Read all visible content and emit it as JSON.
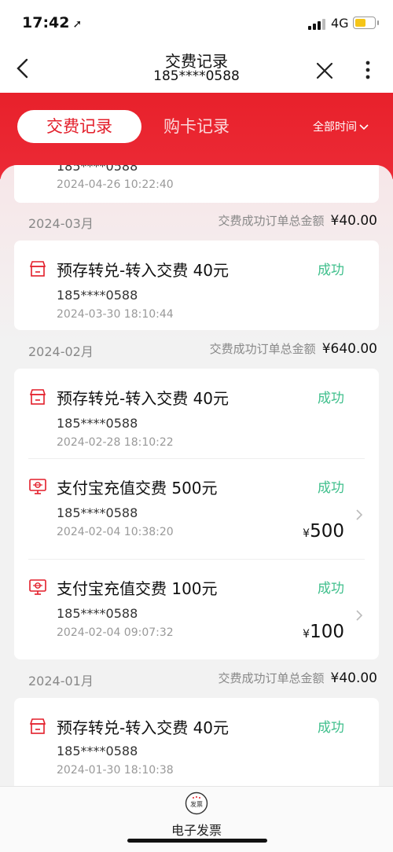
{
  "status_bar": {
    "time": "17:42",
    "network": "4G"
  },
  "navbar": {
    "title": "交费记录",
    "subtitle": "185****0588"
  },
  "tabs": {
    "active": "交费记录",
    "inactive": "购卡记录",
    "filter": "全部时间"
  },
  "partial_record": {
    "phone": "185****0588",
    "time": "2024-04-26 10:22:40"
  },
  "groups": [
    {
      "month": "2024-03月",
      "sum_label": "交费成功订单总金额",
      "sum_value": "¥40.00",
      "records": [
        {
          "icon": "store-icon",
          "title": "预存转兑-转入交费 40元",
          "status": "成功",
          "phone": "185****0588",
          "time": "2024-03-30 18:10:44"
        }
      ]
    },
    {
      "month": "2024-02月",
      "sum_label": "交费成功订单总金额",
      "sum_value": "¥640.00",
      "records": [
        {
          "icon": "store-icon",
          "title": "预存转兑-转入交费 40元",
          "status": "成功",
          "phone": "185****0588",
          "time": "2024-02-28 18:10:22"
        },
        {
          "icon": "unicom-monitor-icon",
          "title": "支付宝充值交费 500元",
          "status": "成功",
          "phone": "185****0588",
          "time": "2024-02-04 10:38:20",
          "amount_currency": "¥",
          "amount": "500"
        },
        {
          "icon": "unicom-monitor-icon",
          "title": "支付宝充值交费 100元",
          "status": "成功",
          "phone": "185****0588",
          "time": "2024-02-04 09:07:32",
          "amount_currency": "¥",
          "amount": "100"
        }
      ]
    },
    {
      "month": "2024-01月",
      "sum_label": "交费成功订单总金额",
      "sum_value": "¥40.00",
      "records": [
        {
          "icon": "store-icon",
          "title": "预存转兑-转入交费 40元",
          "status": "成功",
          "phone": "185****0588",
          "time": "2024-01-30 18:10:38"
        }
      ]
    }
  ],
  "bottom_bar": {
    "icon_text": "发票",
    "label": "电子发票"
  },
  "colors": {
    "brand_red": "#e8212b",
    "success_green": "#3fbf8c"
  }
}
